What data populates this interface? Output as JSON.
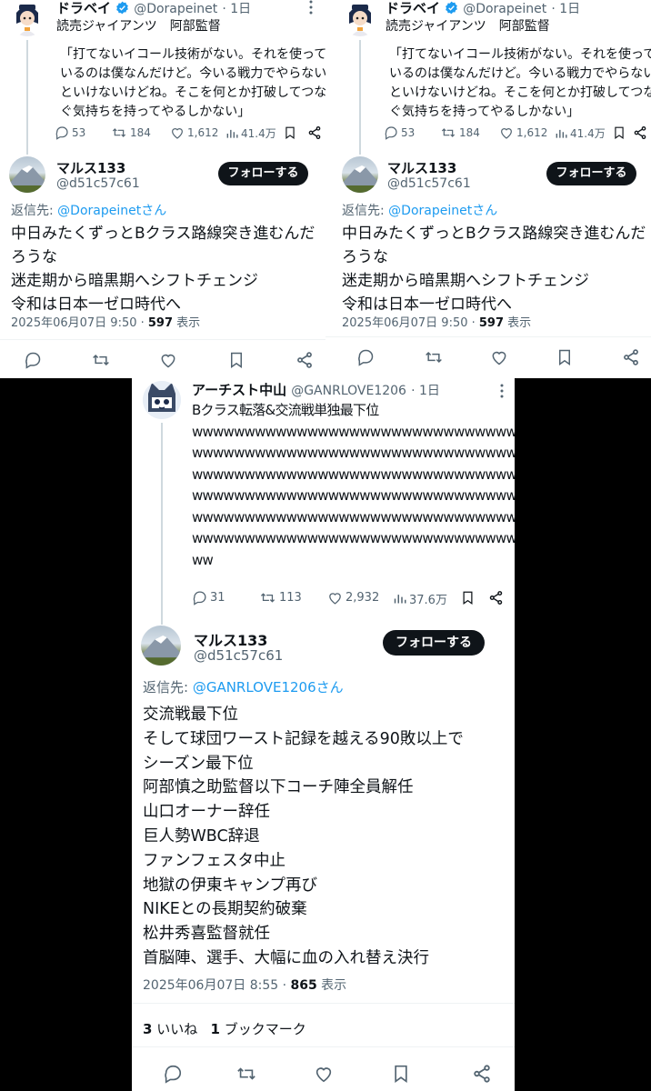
{
  "quoted": {
    "name": "ドラベイ",
    "handle": "@Dorapeinet",
    "time": "· 1日",
    "line1": "読売ジャイアンツ　阿部監督",
    "text": "「打てないイコール技術がない。それを使って\nいるのは僕なんだけど。今いる戦力でやらない\nといけないけどね。そこを何とか打破してつな\nぐ気持ちを持ってやるしかない」",
    "replies": "53",
    "retweets": "184",
    "likes": "1,612",
    "views": "41.4万"
  },
  "reply1": {
    "name": "マルス133",
    "handle": "@d51c57c61",
    "follow": "フォローする",
    "reply_prefix": "返信先: ",
    "reply_to": "@Dorapeinetさん",
    "text": "中日みたくずっとBクラス路線突き進むんだ\nろうな\n迷走期から暗黒期へシフトチェンジ\n令和は日本一ゼロ時代へ",
    "date": "2025年06月07日 9:50 · ",
    "views_num": "597",
    "views_label": " 表示"
  },
  "artist": {
    "name": "アーチスト中山",
    "handle": "@GANRLOVE1206",
    "time": "· 1日",
    "text": "Bクラス転落&交流戦単独最下位\nwwwwwwwwwwwwwwwwwwwwwwwwwwwwwww\nwwwwwwwwwwwwwwwwwwwwwwwwwwwwwww\nwwwwwwwwwwwwwwwwwwwwwwwwwwwwwww\nwwwwwwwwwwwwwwwwwwwwwwwwwwwwwww\nwwwwwwwwwwwwwwwwwwwwwwwwwwwwwww\nwwwwwwwwwwwwwwwwwwwwwwwwwwwwwww\nww",
    "replies": "31",
    "retweets": "113",
    "likes": "2,932",
    "views": "37.6万"
  },
  "reply2": {
    "name": "マルス133",
    "handle": "@d51c57c61",
    "follow": "フォローする",
    "reply_prefix": "返信先: ",
    "reply_to": "@GANRLOVE1206さん",
    "text": "交流戦最下位\nそして球団ワースト記録を越える90敗以上で\nシーズン最下位\n阿部慎之助監督以下コーチ陣全員解任\n山口オーナー辞任\n巨人勢WBC辞退\nファンフェスタ中止\n地獄の伊東キャンプ再び\nNIKEとの長期契約破棄\n松井秀喜監督就任\n首脳陣、選手、大幅に血の入れ替え決行",
    "date": "2025年06月07日 8:55 · ",
    "views_num": "865",
    "views_label": " 表示",
    "likes_num": "3",
    "likes_label": " いいね",
    "bookmarks_num": "1",
    "bookmarks_label": " ブックマーク"
  },
  "colors": {
    "link": "#1d9bf0",
    "text": "#0f1419",
    "muted": "#536471",
    "verified": "#1d9bf0"
  },
  "icons": [
    "reply-icon",
    "retweet-icon",
    "like-icon",
    "views-icon",
    "bookmark-icon",
    "share-icon",
    "verified-icon",
    "more-icon"
  ]
}
